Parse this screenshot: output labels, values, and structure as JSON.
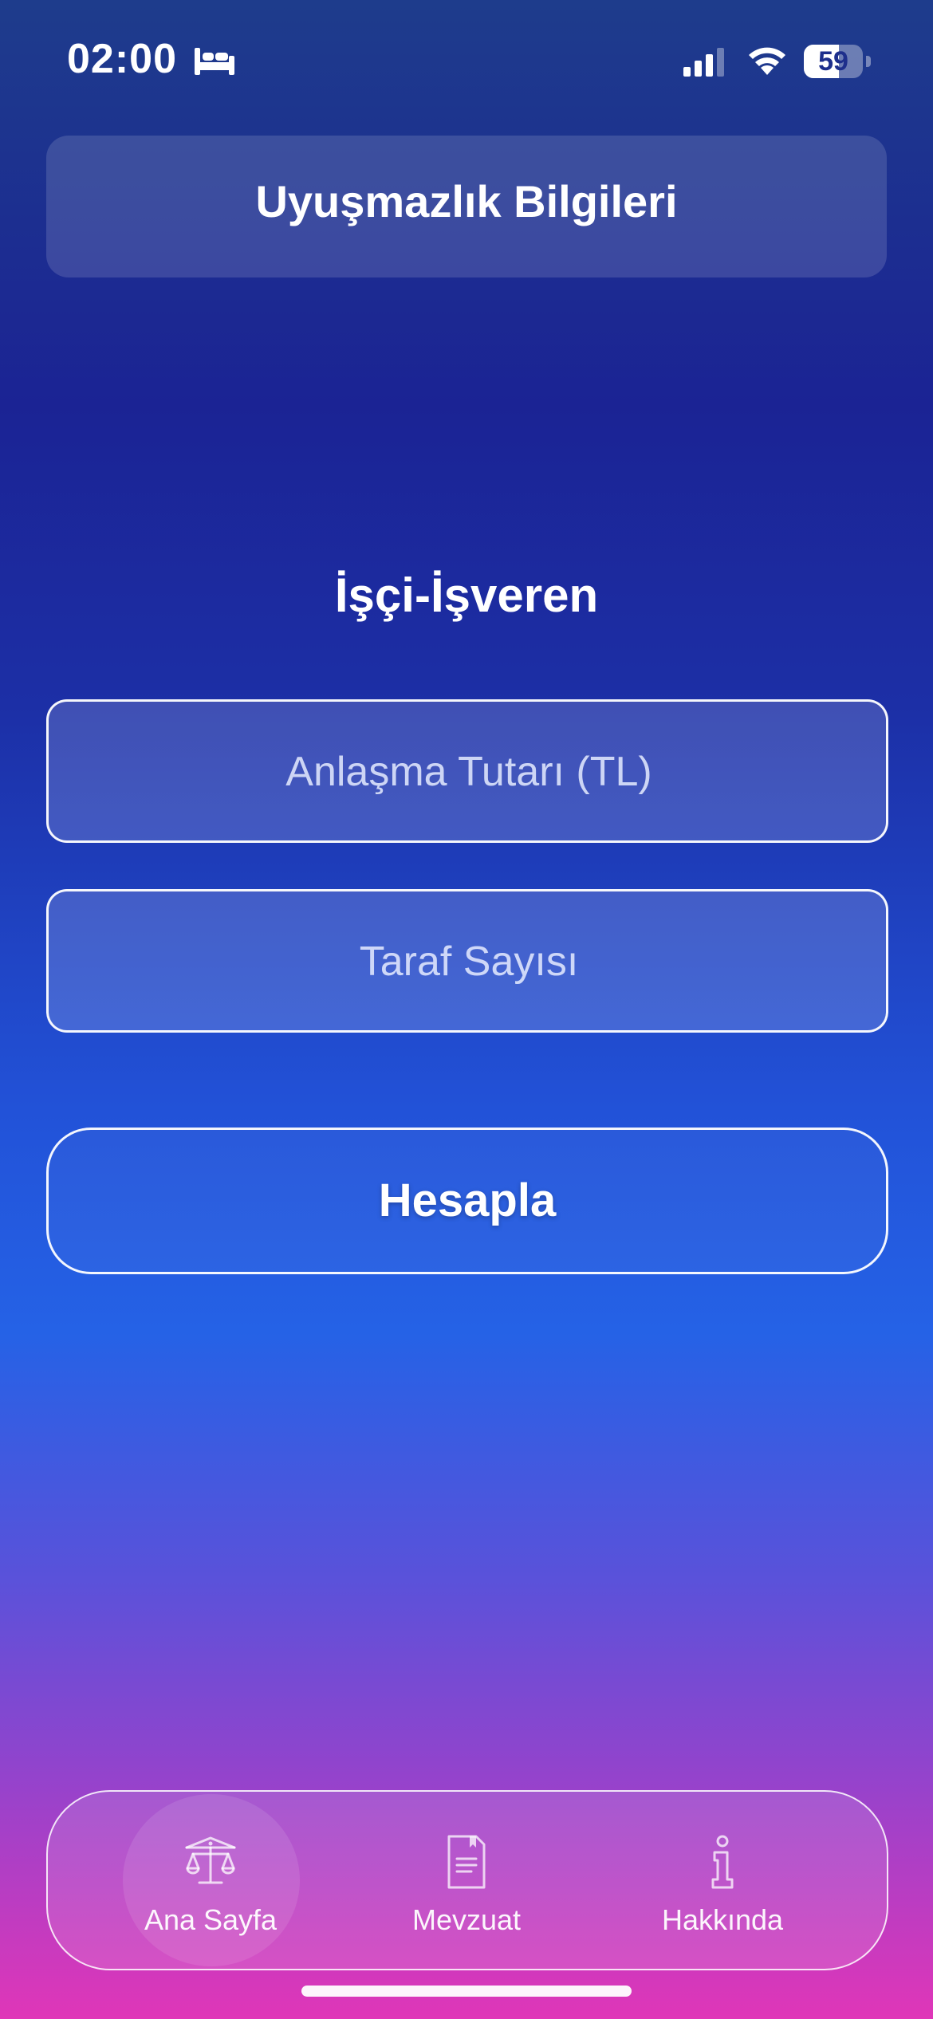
{
  "status_bar": {
    "time": "02:00",
    "battery_level": "59",
    "battery_fraction": 0.59
  },
  "header": {
    "title": "Uyuşmazlık Bilgileri"
  },
  "main": {
    "section_title": "İşçi-İşveren",
    "amount_field": {
      "placeholder": "Anlaşma Tutarı (TL)",
      "value": ""
    },
    "parties_field": {
      "placeholder": "Taraf Sayısı",
      "value": ""
    },
    "calculate_label": "Hesapla"
  },
  "tab_bar": {
    "tabs": [
      {
        "label": "Ana Sayfa",
        "icon": "scales-icon",
        "active": true
      },
      {
        "label": "Mevzuat",
        "icon": "document-icon",
        "active": false
      },
      {
        "label": "Hakkında",
        "icon": "info-icon",
        "active": false
      }
    ]
  }
}
